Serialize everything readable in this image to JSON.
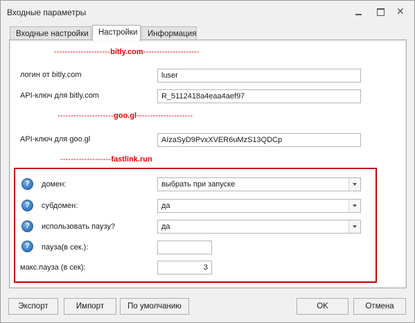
{
  "window": {
    "title": "Входные параметры"
  },
  "tabs": [
    {
      "label": "Входные настройки",
      "active": false
    },
    {
      "label": "Настройки",
      "active": true
    },
    {
      "label": "Информация",
      "active": false
    }
  ],
  "sections": {
    "bitly": {
      "dashes_left": "---------------------",
      "name": "bitly.com",
      "dashes_right": "---------------------"
    },
    "googl": {
      "dashes_left": "---------------------",
      "name": "goo.gl",
      "dashes_right": "---------------------"
    },
    "fastlink": {
      "dashes_left": "-------------------",
      "name": "fastlink.run",
      "dashes_right": ""
    }
  },
  "fields": {
    "bitly_login": {
      "label": "логин от bitly.com",
      "value": "luser"
    },
    "bitly_api": {
      "label": "API-ключ для bitly.com",
      "value": "R_5112418a4eaa4aef97"
    },
    "googl_api": {
      "label": "API-ключ для goo.gl",
      "value": "AIzaSyD9PvxXVER6uMzS13QDCp"
    },
    "domain": {
      "label": "домен:",
      "value": "выбрать при запуске",
      "icon": "help-icon"
    },
    "subdomain": {
      "label": "субдомен:",
      "value": "да",
      "icon": "help-icon"
    },
    "use_pause": {
      "label": "использовать паузу?",
      "value": "да",
      "icon": "help-icon"
    },
    "pause": {
      "label": "пауза(в сек.):",
      "value": "",
      "icon": "help-icon"
    },
    "max_pause": {
      "label": "макс.пауза (в сек):",
      "value": "3"
    }
  },
  "buttons": {
    "export": "Экспорт",
    "import": "Импорт",
    "default": "По умолчанию",
    "ok": "OK",
    "cancel": "Отмена"
  },
  "colors": {
    "accent_red": "#e00000",
    "frame_red": "#c00000",
    "help_blue": "#3d82c9"
  }
}
